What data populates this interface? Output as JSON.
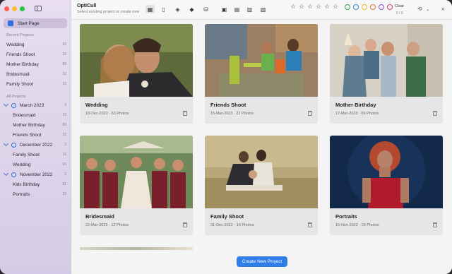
{
  "app": {
    "title": "OptiCull",
    "subtitle": "Select existing project or create new"
  },
  "sidebar": {
    "start_page": "Start Page",
    "recent_title": "Recent Projects",
    "recent": [
      {
        "label": "Wedding",
        "count": "63"
      },
      {
        "label": "Friends Shoot",
        "count": "22"
      },
      {
        "label": "Mother Birthday",
        "count": "89"
      },
      {
        "label": "Bridesmaid",
        "count": "12"
      },
      {
        "label": "Family Shoot",
        "count": "16"
      }
    ],
    "all_title": "All Projects",
    "groups": [
      {
        "label": "March 2023",
        "count": "3",
        "items": [
          {
            "label": "Bridesmaid",
            "count": "12"
          },
          {
            "label": "Mother Birthday",
            "count": "89"
          },
          {
            "label": "Friends Shoot",
            "count": "22"
          }
        ]
      },
      {
        "label": "December 2022",
        "count": "2",
        "items": [
          {
            "label": "Family Shoot",
            "count": "16"
          },
          {
            "label": "Wedding",
            "count": "63"
          }
        ]
      },
      {
        "label": "November 2022",
        "count": "2",
        "items": [
          {
            "label": "Kids Birthday",
            "count": "81"
          },
          {
            "label": "Portraits",
            "count": "29"
          }
        ]
      }
    ]
  },
  "toolbar": {
    "clear_label": "Clear",
    "clear_count": "0 / 6",
    "filter_colors": [
      "#3b9a4f",
      "#2f8fd9",
      "#f0b429",
      "#e56b2e",
      "#8a4fcf",
      "#d23b5b"
    ]
  },
  "projects": [
    {
      "name": "Wedding",
      "date": "18-Dec-2022",
      "photos": "63 Photos"
    },
    {
      "name": "Friends Shoot",
      "date": "15-Mar-2023",
      "photos": "22 Photos"
    },
    {
      "name": "Mother Birthday",
      "date": "17-Mar-2023",
      "photos": "89 Photos"
    },
    {
      "name": "Bridesmaid",
      "date": "22-Mar-2023",
      "photos": "12 Photos"
    },
    {
      "name": "Family Shoot",
      "date": "31-Dec-2022",
      "photos": "16 Photos"
    },
    {
      "name": "Portraits",
      "date": "16-Nov-2022",
      "photos": "29 Photos"
    }
  ],
  "create_button": "Create New Project"
}
